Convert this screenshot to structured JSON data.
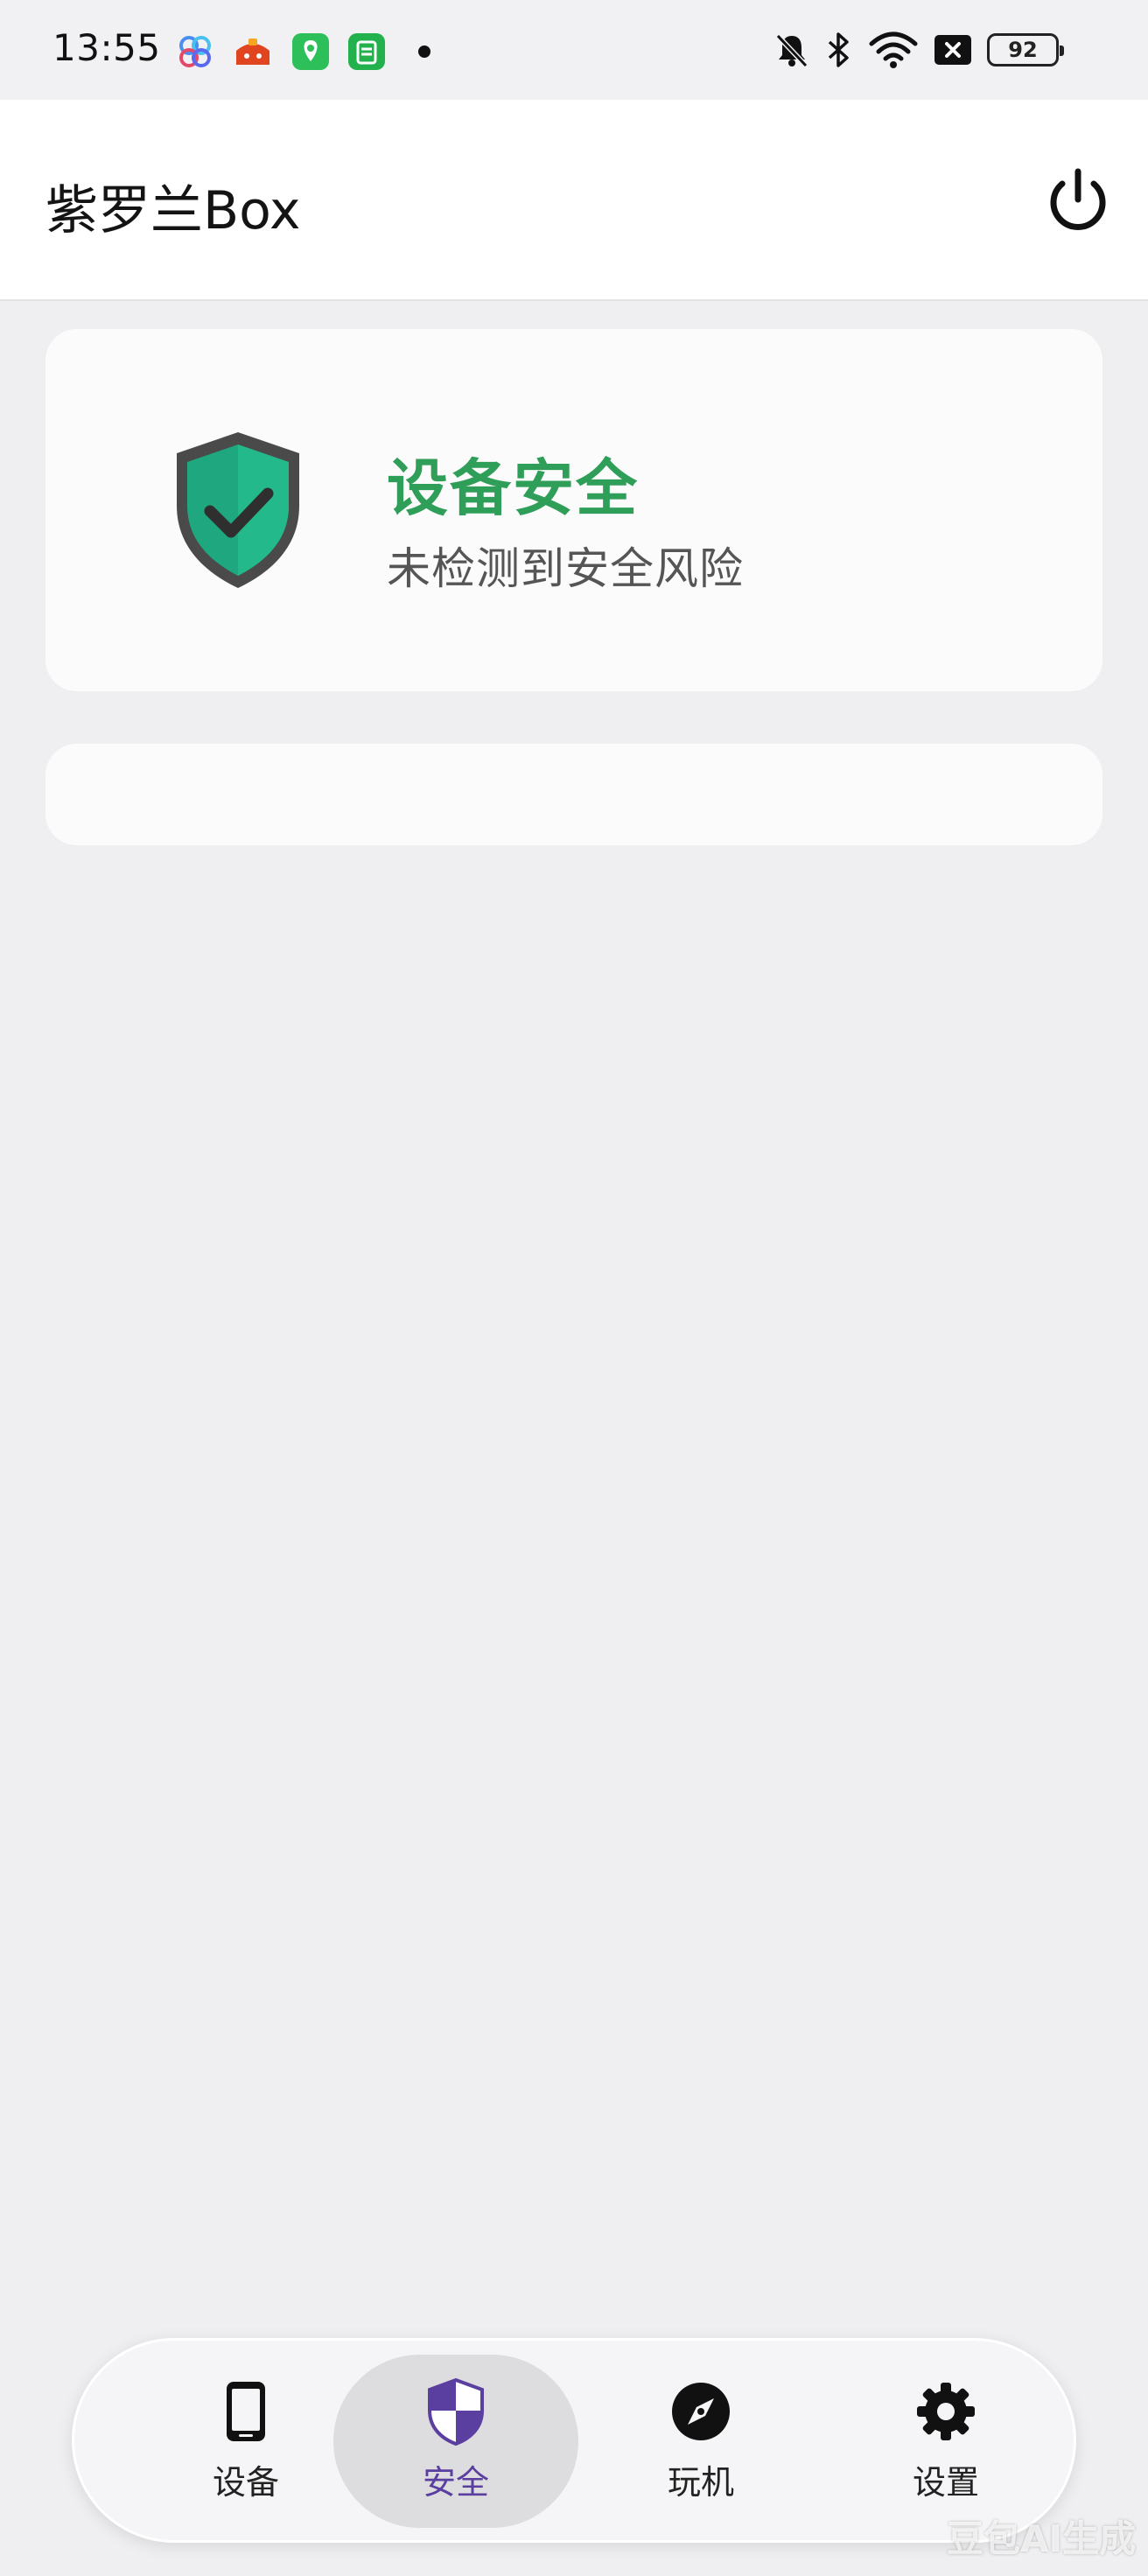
{
  "status_bar": {
    "time": "13:55",
    "battery": "92",
    "icons": [
      "baidu-netdisk-icon",
      "wallet-app-icon",
      "green-app-icon",
      "green-app2-icon",
      "notification-dot-icon",
      "mute-icon",
      "bluetooth-icon",
      "wifi-icon",
      "sim-off-icon"
    ]
  },
  "header": {
    "title": "紫罗兰Box",
    "power_icon": "power-icon"
  },
  "security_card": {
    "icon": "shield-check-icon",
    "title": "设备安全",
    "subtitle": "未检测到安全风险"
  },
  "bottom_nav": {
    "items": [
      {
        "label": "设备",
        "icon": "phone-icon",
        "active": false
      },
      {
        "label": "安全",
        "icon": "shield-icon",
        "active": true
      },
      {
        "label": "玩机",
        "icon": "compass-icon",
        "active": false
      },
      {
        "label": "设置",
        "icon": "gear-icon",
        "active": false
      }
    ]
  },
  "watermark": "豆包AI生成",
  "colors": {
    "accent_green": "#2e9e58",
    "nav_active": "#5b3fa0",
    "shield_green": "#1fa77f"
  }
}
